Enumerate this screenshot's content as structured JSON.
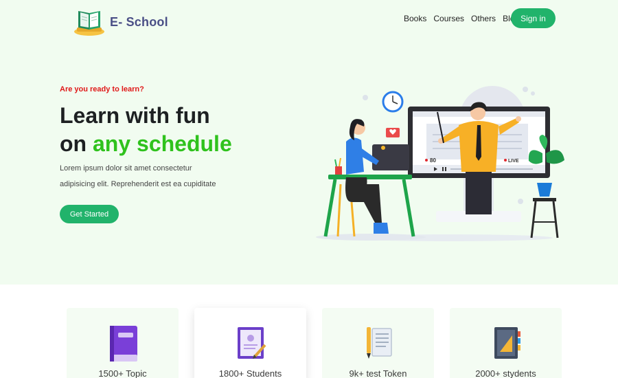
{
  "brand": {
    "name": "E- School"
  },
  "nav": {
    "items": [
      "Books",
      "Courses",
      "Others",
      "Blog"
    ],
    "signin": "Sign in"
  },
  "hero": {
    "eyebrow": "Are you ready to learn?",
    "headline_line1": "Learn with fun",
    "headline_line2_prefix": "on ",
    "headline_line2_accent": "any schedule",
    "description_line1": "Lorem ipsum dolor sit amet consectetur",
    "description_line2": "adipisicing elit. Reprehenderit est ea cupiditate",
    "cta": "Get Started",
    "live_viewers": "80",
    "live_badge": "LIVE"
  },
  "stats": [
    {
      "label": "1500+ Topic",
      "icon": "purple-book-icon"
    },
    {
      "label": "1800+ Students",
      "icon": "certificate-icon"
    },
    {
      "label": "9k+ test Token",
      "icon": "pen-notes-icon"
    },
    {
      "label": "2000+ stydents",
      "icon": "notebook-icon"
    }
  ],
  "colors": {
    "accent_green": "#21b36b",
    "headline_green": "#2fc21d",
    "eyebrow_red": "#e01818",
    "brand_text": "#4a4f86",
    "hero_bg": "#f1fcf0"
  }
}
